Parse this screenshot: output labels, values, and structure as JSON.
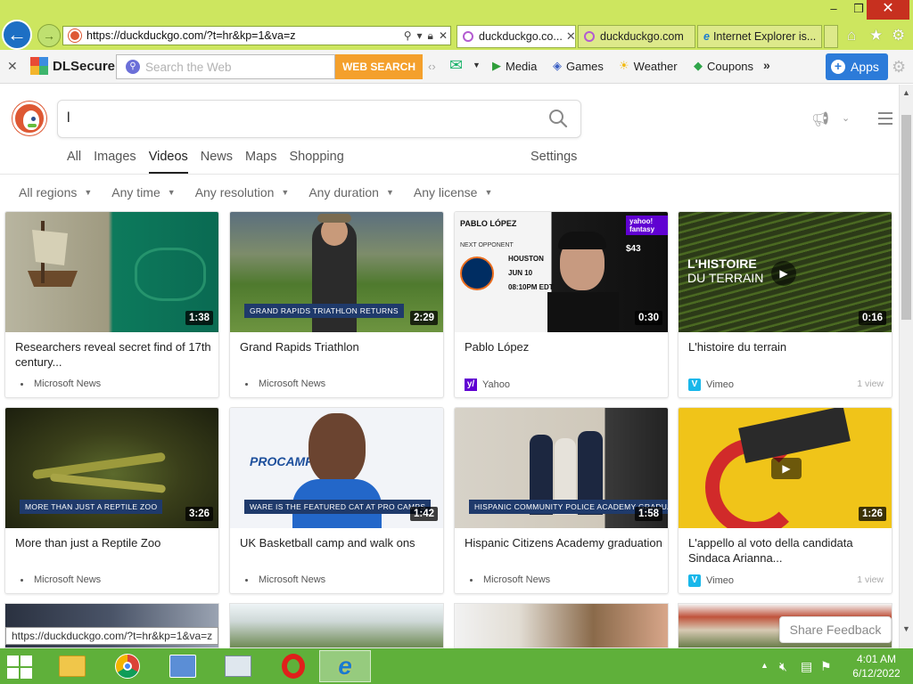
{
  "browser": {
    "address_url": "https://duckduckgo.com/?t=hr&kp=1&va=z",
    "tabs": [
      {
        "label": "duckduckgo.co..."
      },
      {
        "label": "duckduckgo.com"
      },
      {
        "label": "Internet Explorer is..."
      }
    ],
    "window_controls": {
      "minimize": "–",
      "maximize": "❒",
      "close": "✕"
    }
  },
  "toolbar": {
    "brand": "DLSecure",
    "search_placeholder": "Search the Web",
    "search_button": "WEB SEARCH",
    "links": [
      "Media",
      "Games",
      "Weather",
      "Coupons"
    ],
    "more": "»",
    "apps_label": "Apps"
  },
  "ddg": {
    "search_query": "l",
    "nav": [
      "All",
      "Images",
      "Videos",
      "News",
      "Maps",
      "Shopping"
    ],
    "active_nav": "Videos",
    "settings_label": "Settings",
    "filters": [
      "All regions",
      "Any time",
      "Any resolution",
      "Any duration",
      "Any license"
    ],
    "share_feedback": "Share Feedback",
    "hover_url": "https://duckduckgo.com/?t=hr&kp=1&va=z"
  },
  "videos": [
    {
      "title": "Researchers reveal secret find of 17th century...",
      "duration": "1:38",
      "source": "Microsoft News",
      "views": "",
      "caption": ""
    },
    {
      "title": "Grand Rapids Triathlon",
      "duration": "2:29",
      "source": "Microsoft News",
      "views": "",
      "caption": "GRAND RAPIDS TRIATHLON RETURNS"
    },
    {
      "title": "Pablo López",
      "duration": "0:30",
      "source": "Yahoo",
      "views": "",
      "caption": ""
    },
    {
      "title": "L'histoire du terrain",
      "duration": "0:16",
      "source": "Vimeo",
      "views": "1 view",
      "caption": ""
    },
    {
      "title": "More than just a Reptile Zoo",
      "duration": "3:26",
      "source": "Microsoft News",
      "views": "",
      "caption": "MORE THAN JUST A REPTILE ZOO"
    },
    {
      "title": "UK Basketball camp and walk ons",
      "duration": "1:42",
      "source": "Microsoft News",
      "views": "",
      "caption": "WARE IS THE FEATURED CAT AT PRO CAMPS"
    },
    {
      "title": "Hispanic Citizens Academy graduation",
      "duration": "1:58",
      "source": "Microsoft News",
      "views": "",
      "caption": "HISPANIC COMMUNITY POLICE ACADEMY GRADUATION"
    },
    {
      "title": "L'appello al voto della candidata Sindaca Arianna...",
      "duration": "1:26",
      "source": "Vimeo",
      "views": "1 view",
      "caption": ""
    }
  ],
  "thumb_text": {
    "pablo_name": "PABLO LÓPEZ",
    "pablo_next": "NEXT OPPONENT",
    "pablo_team": "HOUSTON",
    "pablo_date": "JUN 10",
    "pablo_time": "08:10PM EDT",
    "pablo_brand": "yahoo! fantasy",
    "pablo_salary": "$43",
    "histoire_line1": "L'HISTOIRE",
    "histoire_line2": "DU TERRAIN",
    "procamps": "PROCAMPS"
  },
  "taskbar": {
    "time": "4:01 AM",
    "date": "6/12/2022"
  },
  "colors": {
    "ie_chrome": "#cde65f",
    "taskbar": "#5fb03a",
    "ddg_orange": "#de5833",
    "web_search": "#f4a02c",
    "apps_blue": "#2c7bd9"
  }
}
